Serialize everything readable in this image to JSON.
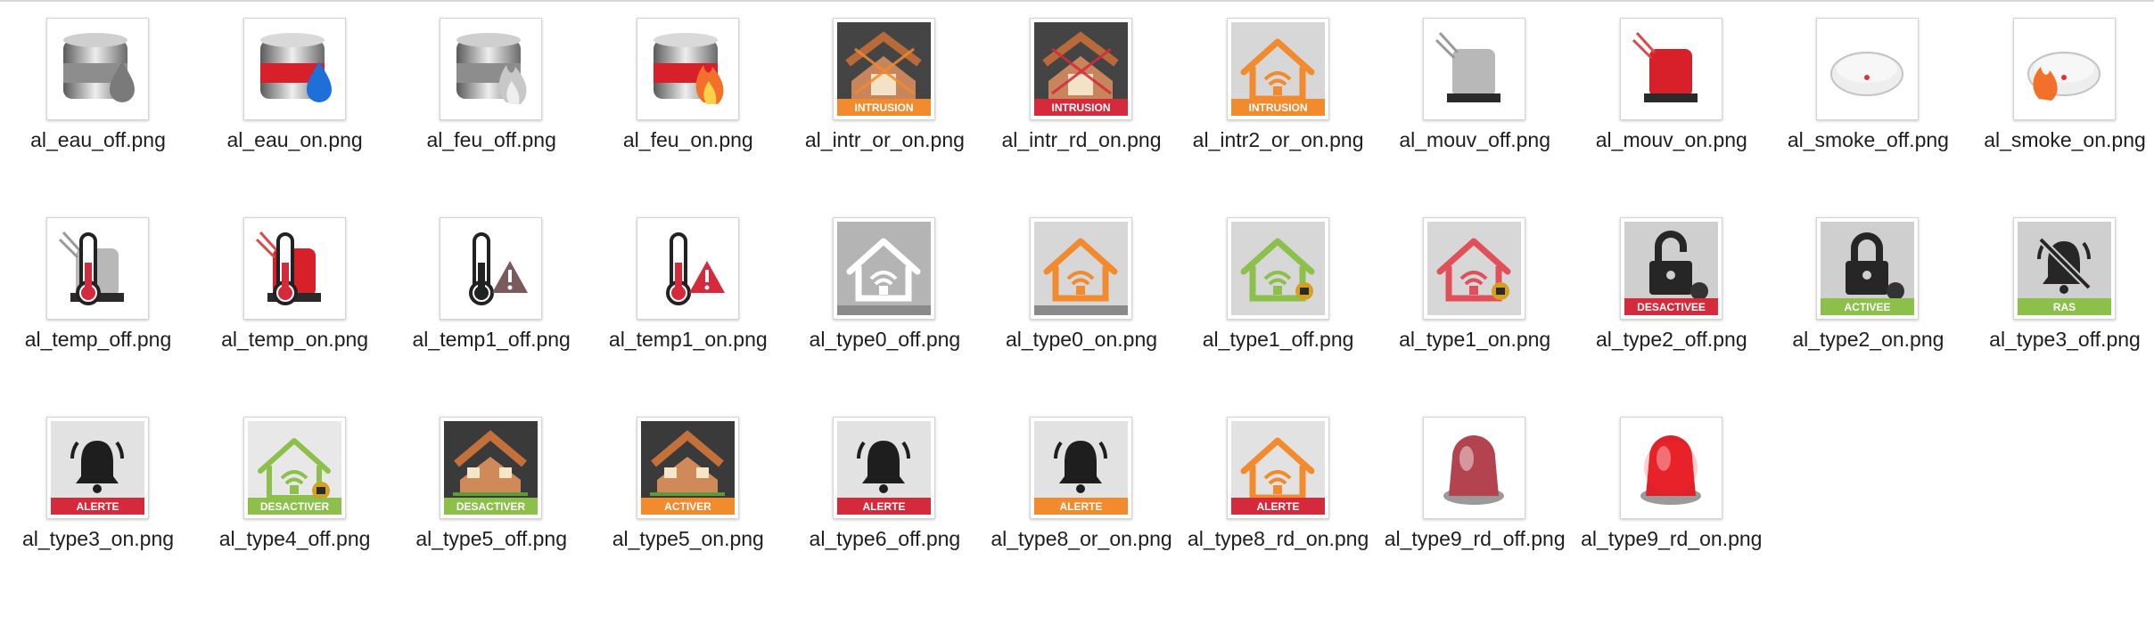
{
  "files": [
    {
      "name": "al_eau_off.png",
      "icon": "water-off-icon"
    },
    {
      "name": "al_eau_on.png",
      "icon": "water-on-icon"
    },
    {
      "name": "al_feu_off.png",
      "icon": "fire-off-icon"
    },
    {
      "name": "al_feu_on.png",
      "icon": "fire-on-icon"
    },
    {
      "name": "al_intr_or_on.png",
      "icon": "intrusion-orange-icon",
      "badge": "INTRUSION"
    },
    {
      "name": "al_intr_rd_on.png",
      "icon": "intrusion-red-icon",
      "badge": "INTRUSION"
    },
    {
      "name": "al_intr2_or_on.png",
      "icon": "intrusion2-orange-icon",
      "badge": "INTRUSION"
    },
    {
      "name": "al_mouv_off.png",
      "icon": "motion-off-icon"
    },
    {
      "name": "al_mouv_on.png",
      "icon": "motion-on-icon"
    },
    {
      "name": "al_smoke_off.png",
      "icon": "smoke-off-icon"
    },
    {
      "name": "al_smoke_on.png",
      "icon": "smoke-on-icon"
    },
    {
      "name": "al_temp_off.png",
      "icon": "temp-off-icon"
    },
    {
      "name": "al_temp_on.png",
      "icon": "temp-on-icon"
    },
    {
      "name": "al_temp1_off.png",
      "icon": "thermometer-warning-off-icon"
    },
    {
      "name": "al_temp1_on.png",
      "icon": "thermometer-warning-on-icon"
    },
    {
      "name": "al_type0_off.png",
      "icon": "house-white-icon"
    },
    {
      "name": "al_type0_on.png",
      "icon": "house-orange-icon"
    },
    {
      "name": "al_type1_off.png",
      "icon": "house-green-lock-icon"
    },
    {
      "name": "al_type1_on.png",
      "icon": "house-red-lock-icon"
    },
    {
      "name": "al_type2_off.png",
      "icon": "padlock-open-icon",
      "badge": "DESACTIVEE"
    },
    {
      "name": "al_type2_on.png",
      "icon": "padlock-closed-icon",
      "badge": "ACTIVEE"
    },
    {
      "name": "al_type3_off.png",
      "icon": "bell-muted-icon",
      "badge": "RAS"
    },
    {
      "name": "al_type3_on.png",
      "icon": "bell-icon",
      "badge": "ALERTE"
    },
    {
      "name": "al_type4_off.png",
      "icon": "house-green-deactivate-icon",
      "badge": "DESACTIVER"
    },
    {
      "name": "al_type5_off.png",
      "icon": "house-photo-deactivate-icon",
      "badge": "DESACTIVER"
    },
    {
      "name": "al_type5_on.png",
      "icon": "house-photo-activate-icon",
      "badge": "ACTIVER"
    },
    {
      "name": "al_type6_off.png",
      "icon": "bell-alert-icon",
      "badge": "ALERTE"
    },
    {
      "name": "al_type8_or_on.png",
      "icon": "bell-orange-alert-icon",
      "badge": "ALERTE"
    },
    {
      "name": "al_type8_rd_on.png",
      "icon": "house-orange-alert-icon",
      "badge": "ALERTE"
    },
    {
      "name": "al_type9_rd_off.png",
      "icon": "beacon-off-icon"
    },
    {
      "name": "al_type9_rd_on.png",
      "icon": "beacon-on-icon"
    }
  ],
  "colors": {
    "orange": "#f28a2e",
    "red": "#d42a3c",
    "green": "#8cc04a",
    "dark": "#222222"
  }
}
